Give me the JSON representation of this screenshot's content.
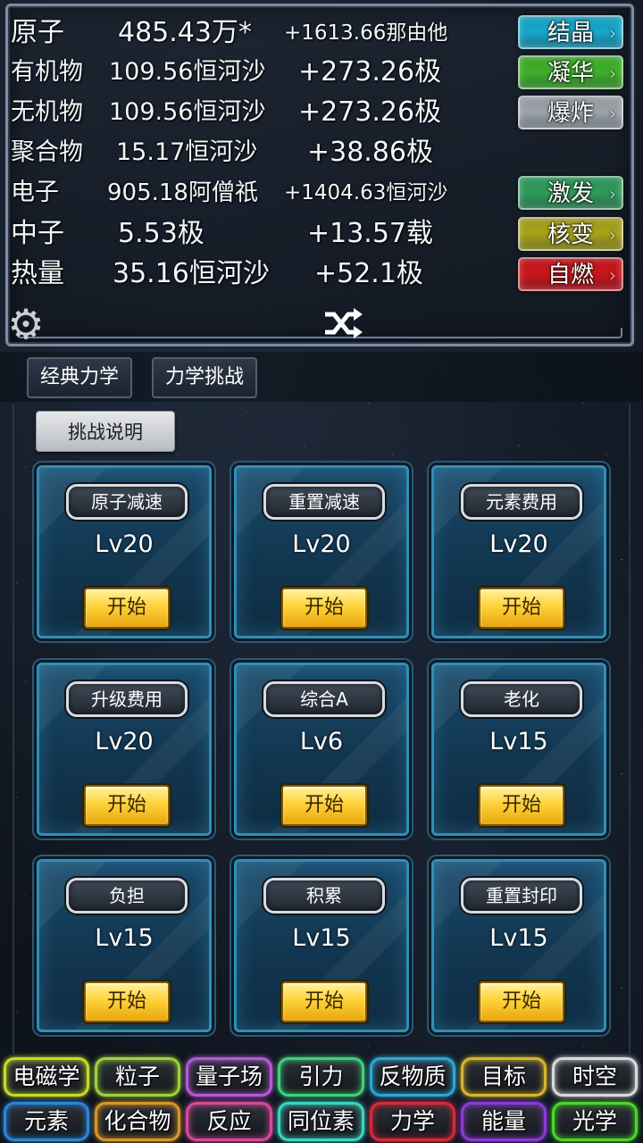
{
  "resources": [
    {
      "name": "原子",
      "amount": "485.43万*",
      "rate": "+1613.66那由他"
    },
    {
      "name": "有机物",
      "amount": "109.56恒河沙",
      "rate": "+273.26极"
    },
    {
      "name": "无机物",
      "amount": "109.56恒河沙",
      "rate": "+273.26极"
    },
    {
      "name": "聚合物",
      "amount": "15.17恒河沙",
      "rate": "+38.86极"
    },
    {
      "name": "电子",
      "amount": "905.18阿僧祇",
      "rate": "+1404.63恒河沙"
    },
    {
      "name": "中子",
      "amount": "5.53极",
      "rate": "+13.57载"
    },
    {
      "name": "热量",
      "amount": "35.16恒河沙",
      "rate": "+52.1极"
    }
  ],
  "actions": [
    {
      "label": "结晶",
      "color": "#17a6c8"
    },
    {
      "label": "凝华",
      "color": "#3fae2a"
    },
    {
      "label": "爆炸",
      "color": "#9aa2a8"
    },
    {
      "label": "激发",
      "color": "#2f9a5a"
    },
    {
      "label": "核变",
      "color": "#a6a21a"
    },
    {
      "label": "自燃",
      "color": "#c8161c"
    }
  ],
  "icons": {
    "settings": "gear-icon",
    "shuffle": "shuffle-icon"
  },
  "tabs": [
    {
      "label": "经典力学"
    },
    {
      "label": "力学挑战"
    }
  ],
  "help_label": "挑战说明",
  "challenges": [
    {
      "title": "原子减速",
      "level": "Lv20",
      "start": "开始"
    },
    {
      "title": "重置减速",
      "level": "Lv20",
      "start": "开始"
    },
    {
      "title": "元素费用",
      "level": "Lv20",
      "start": "开始"
    },
    {
      "title": "升级费用",
      "level": "Lv20",
      "start": "开始"
    },
    {
      "title": "综合A",
      "level": "Lv6",
      "start": "开始"
    },
    {
      "title": "老化",
      "level": "Lv15",
      "start": "开始"
    },
    {
      "title": "负担",
      "level": "Lv15",
      "start": "开始"
    },
    {
      "title": "积累",
      "level": "Lv15",
      "start": "开始"
    },
    {
      "title": "重置封印",
      "level": "Lv15",
      "start": "开始"
    }
  ],
  "nav_row1": [
    {
      "label": "电磁学",
      "color": "#c7dc2a"
    },
    {
      "label": "粒子",
      "color": "#9fd13a"
    },
    {
      "label": "量子场",
      "color": "#b35ad6"
    },
    {
      "label": "引力",
      "color": "#3fd17a"
    },
    {
      "label": "反物质",
      "color": "#2aa8d6"
    },
    {
      "label": "目标",
      "color": "#d6b62a"
    },
    {
      "label": "时空",
      "color": "#d8dadd"
    }
  ],
  "nav_row2": [
    {
      "label": "元素",
      "color": "#2a86d6"
    },
    {
      "label": "化合物",
      "color": "#d6962a"
    },
    {
      "label": "反应",
      "color": "#d64a9a"
    },
    {
      "label": "同位素",
      "color": "#3ad6c0"
    },
    {
      "label": "力学",
      "color": "#d62a3a"
    },
    {
      "label": "能量",
      "color": "#8a3ad6"
    },
    {
      "label": "光学",
      "color": "#4ad62a"
    }
  ]
}
